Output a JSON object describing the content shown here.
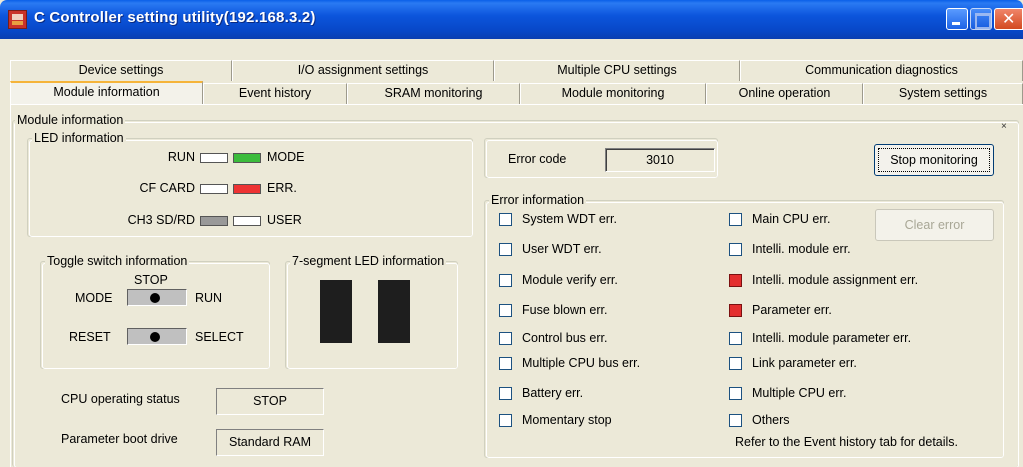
{
  "window": {
    "title": "C Controller setting utility(192.168.3.2)"
  },
  "tabs_row1": [
    "Device settings",
    "I/O assignment settings",
    "Multiple CPU settings",
    "Communication diagnostics"
  ],
  "tabs_row2": [
    "Module information",
    "Event history",
    "SRAM monitoring",
    "Module monitoring",
    "Online operation",
    "System settings"
  ],
  "active_tab": "Module information",
  "module_info": {
    "group_title": "Module information",
    "close_mark": "×",
    "led": {
      "group_title": "LED information",
      "rows": [
        {
          "left_label": "RUN",
          "left_state": "off",
          "right_state": "green",
          "right_label": "MODE"
        },
        {
          "left_label": "CF CARD",
          "left_state": "off",
          "right_state": "red",
          "right_label": "ERR."
        },
        {
          "left_label": "CH3 SD/RD",
          "left_state": "gray",
          "right_state": "off",
          "right_label": "USER"
        }
      ]
    },
    "toggle": {
      "group_title": "Toggle switch information",
      "stop_label": "STOP",
      "mode_label": "MODE",
      "run_label": "RUN",
      "reset_label": "RESET",
      "select_label": "SELECT"
    },
    "seven_seg": {
      "group_title": "7-segment LED information"
    },
    "cpu_status": {
      "label": "CPU operating status",
      "value": "STOP"
    },
    "boot_drive": {
      "label": "Parameter boot drive",
      "value": "Standard RAM"
    },
    "error_code": {
      "label": "Error code",
      "value": "3010"
    },
    "stop_monitoring_button": "Stop monitoring",
    "clear_error_button": "Clear error",
    "error_info": {
      "group_title": "Error information",
      "left": [
        {
          "label": "System WDT err.",
          "checked": false
        },
        {
          "label": "User WDT err.",
          "checked": false
        },
        {
          "label": "Module verify err.",
          "checked": false
        },
        {
          "label": "Fuse blown err.",
          "checked": false
        },
        {
          "label": "Control bus err.",
          "checked": false
        },
        {
          "label": "Multiple CPU bus err.",
          "checked": false
        },
        {
          "label": "Battery err.",
          "checked": false
        },
        {
          "label": "Momentary stop",
          "checked": false
        }
      ],
      "right": [
        {
          "label": "Main CPU err.",
          "checked": false
        },
        {
          "label": "Intelli. module err.",
          "checked": false
        },
        {
          "label": "Intelli. module assignment err.",
          "checked": true
        },
        {
          "label": "Parameter err.",
          "checked": true
        },
        {
          "label": "Intelli. module parameter err.",
          "checked": false
        },
        {
          "label": "Link parameter err.",
          "checked": false
        },
        {
          "label": "Multiple CPU err.",
          "checked": false
        },
        {
          "label": "Others",
          "checked": false
        }
      ],
      "note": "Refer to the Event history tab for details."
    }
  },
  "colors": {
    "led_green": "#3cbc3c",
    "led_red": "#ee3333",
    "titlebar_blue": "#0c55dc",
    "tab_highlight": "#f5b43a"
  }
}
